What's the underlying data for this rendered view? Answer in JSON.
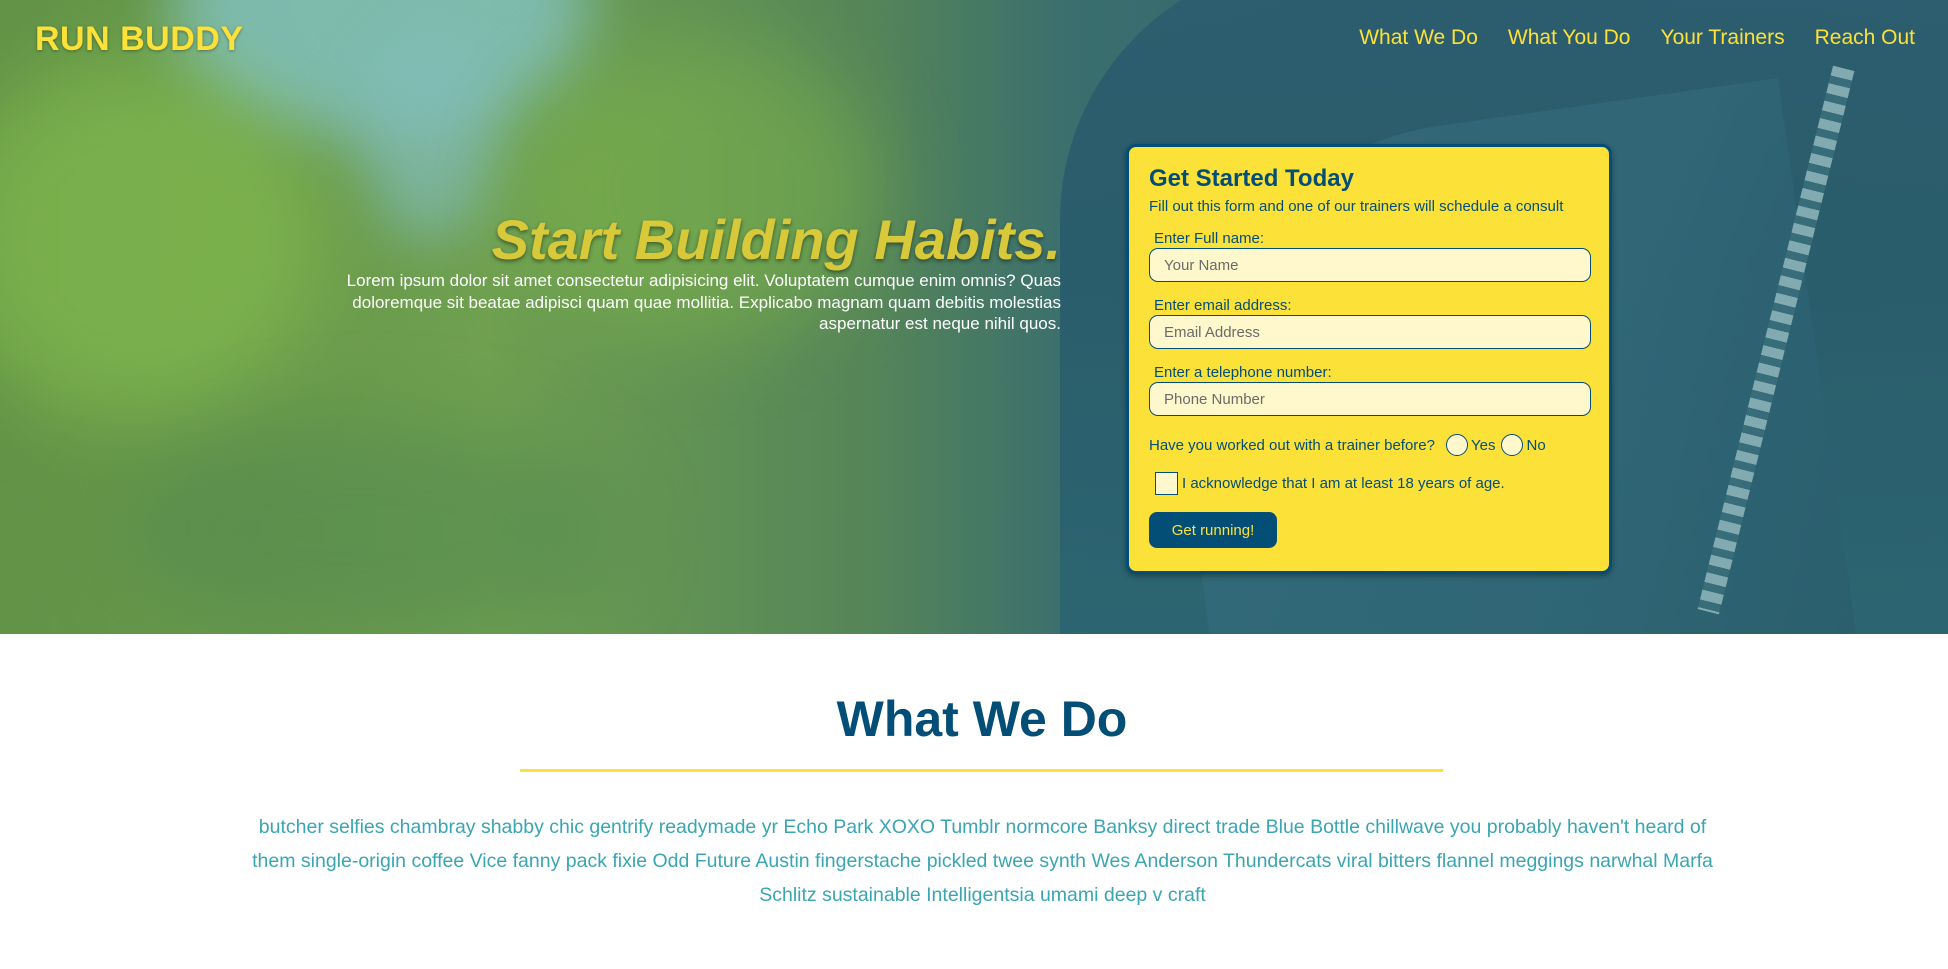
{
  "header": {
    "logo": "RUN BUDDY",
    "nav": [
      {
        "label": "What We Do"
      },
      {
        "label": "What You Do"
      },
      {
        "label": "Your Trainers"
      },
      {
        "label": "Reach Out"
      }
    ]
  },
  "hero": {
    "title": "Start Building Habits.",
    "description": "Lorem ipsum dolor sit amet consectetur adipisicing elit. Voluptatem cumque enim omnis? Quas doloremque sit beatae adipisci quam quae mollitia. Explicabo magnam quam debitis molestias aspernatur est neque nihil quos."
  },
  "form": {
    "title": "Get Started Today",
    "subtitle": "Fill out this form and one of our trainers will schedule a consult",
    "name_label": "Enter Full name:",
    "name_placeholder": "Your Name",
    "email_label": "Enter email address:",
    "email_placeholder": "Email Address",
    "phone_label": "Enter a telephone number:",
    "phone_placeholder": "Phone Number",
    "trainer_question": "Have you worked out with a trainer before?",
    "yes_label": "Yes",
    "no_label": "No",
    "age_ack": "I acknowledge that I am at least 18 years of age.",
    "submit_label": "Get running!"
  },
  "what_we_do": {
    "title": "What We Do",
    "body": "butcher selfies chambray shabby chic gentrify readymade yr Echo Park XOXO Tumblr normcore Banksy direct trade Blue Bottle chillwave you probably haven't heard of them single-origin coffee Vice fanny pack fixie Odd Future Austin fingerstache pickled twee synth Wes Anderson Thundercats viral bitters flannel meggings narwhal Marfa Schlitz sustainable Intelligentsia umami deep v craft"
  },
  "colors": {
    "primary_blue": "#024e76",
    "accent_yellow": "#fce138",
    "teal_text": "#39a6b2"
  }
}
